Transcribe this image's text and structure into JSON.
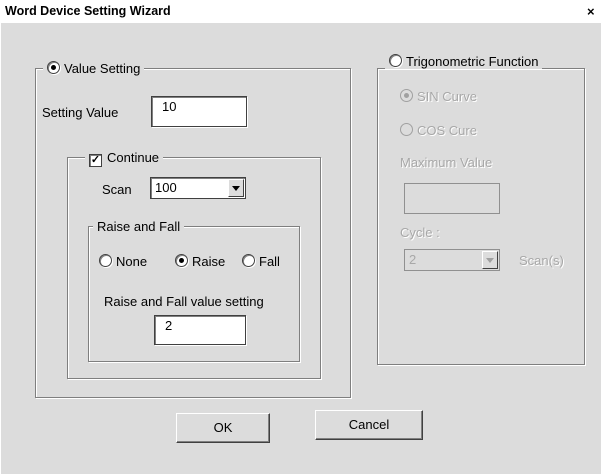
{
  "window": {
    "title": "Word Device Setting Wizard",
    "close_glyph": "×"
  },
  "value_setting": {
    "label": "Value Setting",
    "selected": true,
    "setting_value_label": "Setting Value",
    "setting_value": "10",
    "continue": {
      "label": "Continue",
      "checked": true,
      "scan_label": "Scan",
      "scan_value": "100",
      "raise_and_fall": {
        "label": "Raise and Fall",
        "options": [
          {
            "label": "None",
            "selected": false
          },
          {
            "label": "Raise",
            "selected": true
          },
          {
            "label": "Fall",
            "selected": false
          }
        ],
        "value_label": "Raise and Fall value setting",
        "value": "2"
      }
    }
  },
  "trig_function": {
    "label": "Trigonometric Function",
    "selected": false,
    "sin_label": "SIN Curve",
    "cos_label": "COS Cure",
    "max_value_label": "Maximum Value",
    "max_value": "",
    "cycle_label": "Cycle :",
    "cycle_value": "2",
    "scan_unit": "Scan(s)"
  },
  "buttons": {
    "ok": "OK",
    "cancel": "Cancel"
  },
  "check_glyph": "✓"
}
